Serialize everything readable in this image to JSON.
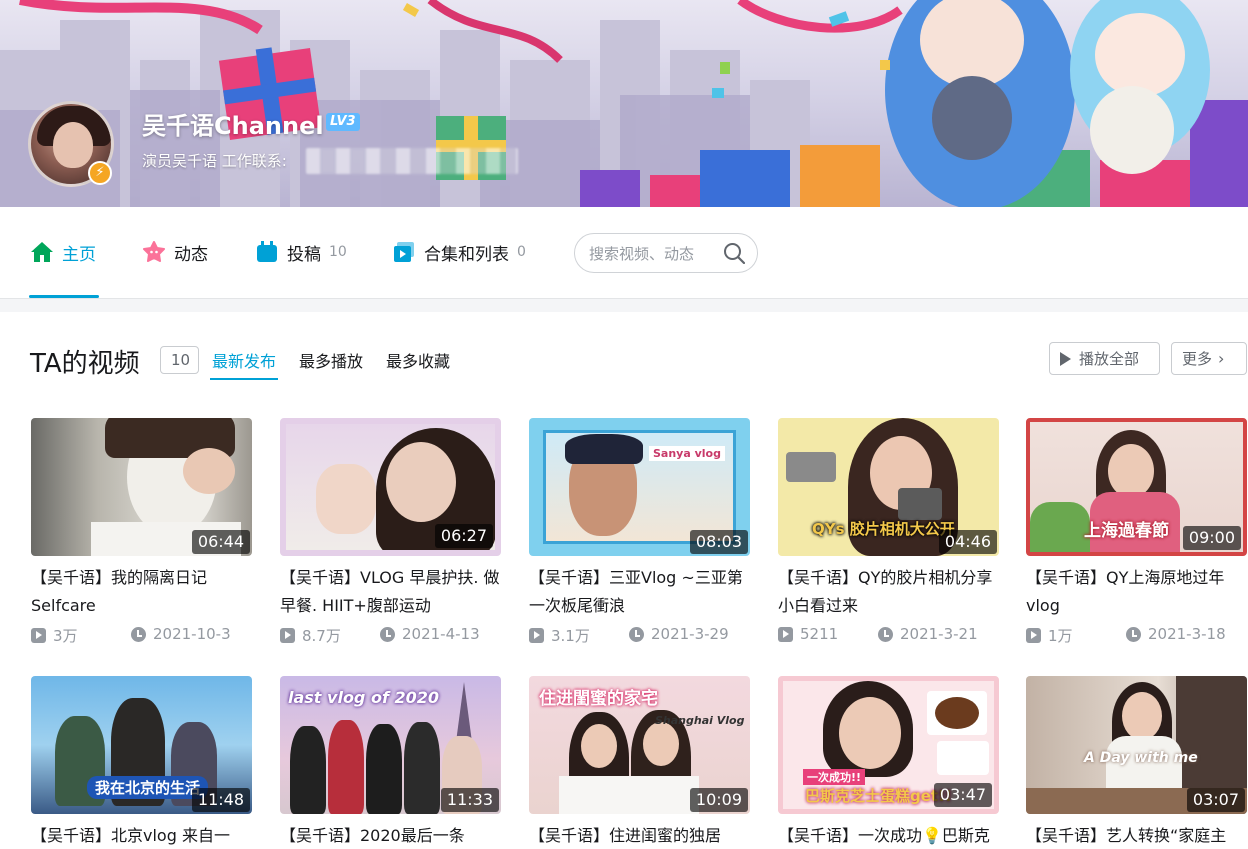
{
  "profile": {
    "name": "吴千语Channel",
    "level": "LV3",
    "sign": "演员吴千语 工作联系:"
  },
  "nav": {
    "items": [
      {
        "label": "主页",
        "count": "",
        "icon": "home-icon"
      },
      {
        "label": "动态",
        "count": "",
        "icon": "dynamic-icon"
      },
      {
        "label": "投稿",
        "count": "10",
        "icon": "upload-icon"
      },
      {
        "label": "合集和列表",
        "count": "0",
        "icon": "collection-icon"
      }
    ],
    "search_placeholder": "搜索视频、动态"
  },
  "section": {
    "title": "TA的视频",
    "count": "10",
    "sorts": [
      "最新发布",
      "最多播放",
      "最多收藏"
    ],
    "play_all": "播放全部",
    "more": "更多"
  },
  "colors": {
    "accent": "#00a1d6",
    "text": "#18191c",
    "muted": "#9499a0"
  },
  "videos": [
    {
      "title": "【吴千语】我的隔离日记Selfcare",
      "duration": "06:44",
      "views": "3万",
      "date": "2021-10-3"
    },
    {
      "title": "【吴千语】VLOG 早晨护扶. 做早餐. HIIT+腹部运动",
      "duration": "06:27",
      "views": "8.7万",
      "date": "2021-4-13"
    },
    {
      "title": "【吴千语】三亚Vlog ~三亚第一次板尾衝浪",
      "duration": "08:03",
      "views": "3.1万",
      "date": "2021-3-29"
    },
    {
      "title": "【吴千语】QY的胶片相机分享 小白看过来",
      "duration": "04:46",
      "views": "5211",
      "date": "2021-3-21"
    },
    {
      "title": "【吴千语】QY上海原地过年vlog",
      "duration": "09:00",
      "views": "1万",
      "date": "2021-3-18"
    },
    {
      "title": "【吴千语】北京vlog 来自一",
      "duration": "11:48",
      "views": "",
      "date": ""
    },
    {
      "title": "【吴千语】2020最后一条",
      "duration": "11:33",
      "views": "",
      "date": ""
    },
    {
      "title": "【吴千语】住进闺蜜的独居",
      "duration": "10:09",
      "views": "",
      "date": ""
    },
    {
      "title": "【吴千语】一次成功💡巴斯克",
      "duration": "03:47",
      "views": "",
      "date": ""
    },
    {
      "title": "【吴千语】艺人转换“家庭主",
      "duration": "03:07",
      "views": "",
      "date": ""
    }
  ],
  "thumb_text": {
    "v3_sign": "Sanya vlog",
    "v4_caption": "QYs 胶片相机大公开",
    "v5_caption": "上海過春節",
    "v6_caption": "我在北京的生活",
    "v7_caption": "last vlog of 2020",
    "v8_caption": "住进閨蜜的家宅",
    "v8_sub": "Shanghai Vlog",
    "v9_caption": "巴斯克芝士蛋糕get!!",
    "v9_tag": "一次成功!!",
    "v10_caption": "A Day with me"
  }
}
